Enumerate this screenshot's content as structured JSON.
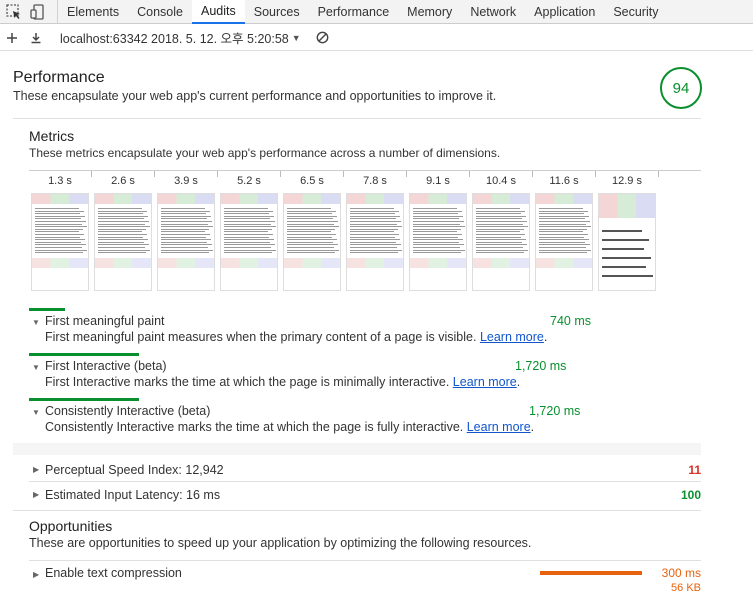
{
  "tabs": [
    "Elements",
    "Console",
    "Audits",
    "Sources",
    "Performance",
    "Memory",
    "Network",
    "Application",
    "Security"
  ],
  "active_tab": "Audits",
  "toolbar": {
    "report_label": "localhost:63342 2018. 5. 12. 오후 5:20:58"
  },
  "performance": {
    "title": "Performance",
    "description": "These encapsulate your web app's current performance and opportunities to improve it.",
    "score": "94",
    "score_color": "#0a8f2e"
  },
  "metrics": {
    "title": "Metrics",
    "description": "These metrics encapsulate your web app's performance across a number of dimensions.",
    "filmstrip": [
      "1.3 s",
      "2.6 s",
      "3.9 s",
      "5.2 s",
      "6.5 s",
      "7.8 s",
      "9.1 s",
      "10.4 s",
      "11.6 s",
      "12.9 s"
    ],
    "items": [
      {
        "name": "First meaningful paint",
        "value": "740 ms",
        "description": "First meaningful paint measures when the primary content of a page is visible.",
        "link": "Learn more",
        "period": "."
      },
      {
        "name": "First Interactive (beta)",
        "value": "1,720 ms",
        "description": "First Interactive marks the time at which the page is minimally interactive.",
        "link": "Learn more",
        "period": "."
      },
      {
        "name": "Consistently Interactive (beta)",
        "value": "1,720 ms",
        "description": "Consistently Interactive marks the time at which the page is fully interactive.",
        "link": "Learn more",
        "period": "."
      }
    ],
    "aux": [
      {
        "label": "Perceptual Speed Index: 12,942",
        "score": "11",
        "color": "#d93025"
      },
      {
        "label": "Estimated Input Latency: 16 ms",
        "score": "100",
        "color": "#0a8f2e"
      }
    ]
  },
  "opportunities": {
    "title": "Opportunities",
    "description": "These are opportunities to speed up your application by optimizing the following resources.",
    "items": [
      {
        "label": "Enable text compression",
        "time": "300 ms",
        "size": "56 KB",
        "color": "#e8620e"
      }
    ]
  },
  "colors": {
    "accent_green": "#0a8f2e",
    "link_blue": "#1155cc",
    "tab_underline": "#1a73e8",
    "opportunity_orange": "#e8620e",
    "fail_red": "#d93025"
  }
}
